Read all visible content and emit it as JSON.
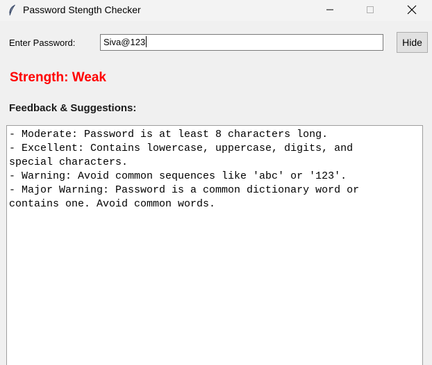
{
  "window": {
    "title": "Password Stength Checker",
    "icon": "feather-icon"
  },
  "password": {
    "label": "Enter Password:",
    "value": "Siva@123"
  },
  "toggle_button_label": "Hide",
  "strength": {
    "text": "Strength: Weak",
    "color": "#ff0000"
  },
  "feedback": {
    "title": "Feedback & Suggestions:",
    "lines": [
      "- Moderate: Password is at least 8 characters long.",
      "- Excellent: Contains lowercase, uppercase, digits, and",
      "special characters.",
      "- Warning: Avoid common sequences like 'abc' or '123'.",
      "- Major Warning: Password is a common dictionary word or",
      "contains one. Avoid common words."
    ]
  }
}
